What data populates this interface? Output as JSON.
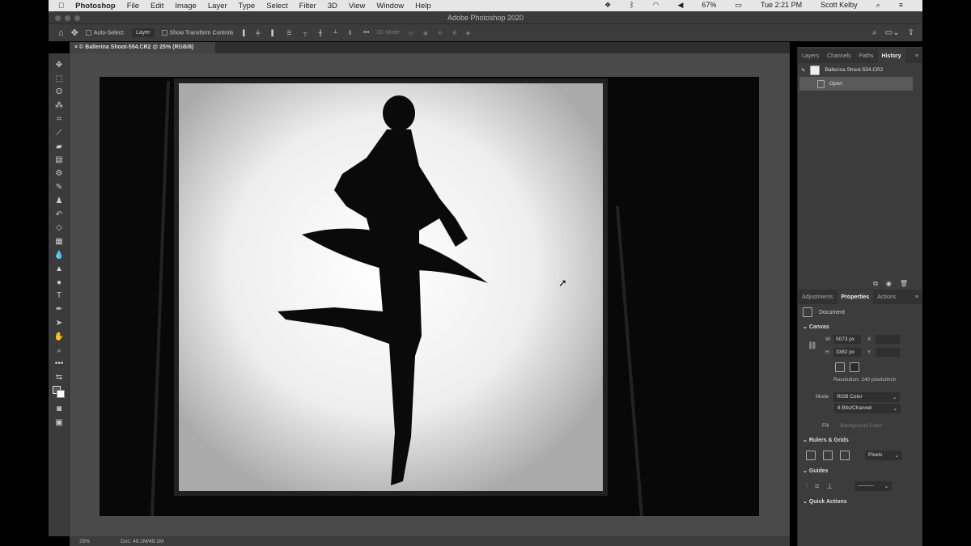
{
  "menubar": {
    "app": "Photoshop",
    "items": [
      "File",
      "Edit",
      "Image",
      "Layer",
      "Type",
      "Select",
      "Filter",
      "3D",
      "View",
      "Window",
      "Help"
    ],
    "battery": "67%",
    "clock": "Tue 2:21 PM",
    "user": "Scott Kelby"
  },
  "window": {
    "title": "Adobe Photoshop 2020"
  },
  "options": {
    "auto_select_label": "Auto-Select:",
    "auto_select_value": "Layer",
    "show_transform": "Show Transform Controls",
    "mode_3d": "3D Mode:"
  },
  "document": {
    "tab": "© Ballerina Shoot-554.CR2 @ 25% (RGB/8)",
    "zoom": "25%",
    "doc_size": "Doc: 49.1M/49.1M"
  },
  "panels": {
    "top_tabs": [
      "Layers",
      "Channels",
      "Paths",
      "History"
    ],
    "history": {
      "snapshot": "Ballerina Shoot-554.CR2",
      "states": [
        "Open"
      ]
    },
    "bottom_tabs": [
      "Adjustments",
      "Properties",
      "Actions"
    ],
    "properties": {
      "type": "Document",
      "canvas_title": "Canvas",
      "w_label": "W",
      "w": "5073 px",
      "h_label": "H",
      "h": "3382 px",
      "x_label": "X",
      "y_label": "Y",
      "resolution": "Resolution: 240 pixels/inch",
      "mode_label": "Mode",
      "mode": "RGB Color",
      "bits": "8 Bits/Channel",
      "fill_label": "Fill",
      "fill": "Background Color",
      "rulers_title": "Rulers & Grids",
      "units": "Pixels",
      "guides_title": "Guides",
      "quick_actions_title": "Quick Actions"
    }
  }
}
